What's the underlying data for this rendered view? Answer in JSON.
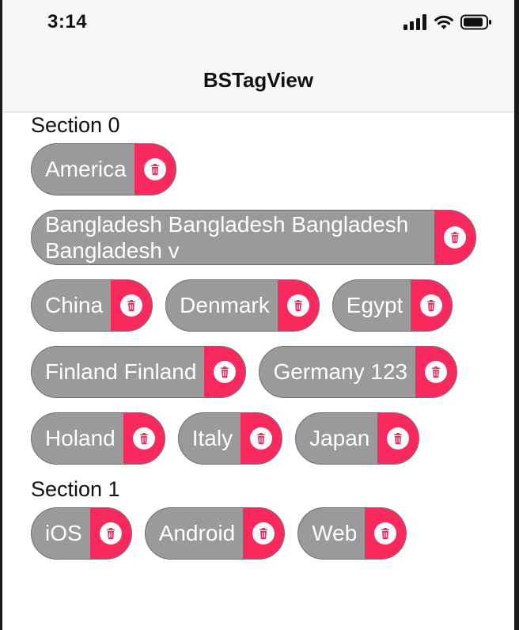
{
  "status_bar": {
    "time": "3:14"
  },
  "nav": {
    "title": "BSTagView"
  },
  "colors": {
    "tag_background": "#9a9a9a",
    "delete_background": "#f8295c"
  },
  "sections": [
    {
      "title": "Section 0",
      "tags": [
        "America",
        "Bangladesh Bangladesh Bangladesh Bangladesh v",
        "China",
        "Denmark",
        "Egypt",
        "Finland Finland",
        "Germany 123",
        "Holand",
        "Italy",
        "Japan"
      ]
    },
    {
      "title": "Section 1",
      "tags": [
        "iOS",
        "Android",
        "Web"
      ]
    }
  ],
  "icons": {
    "delete": "trash-icon",
    "signal": "cellular-signal-icon",
    "wifi": "wifi-icon",
    "battery": "battery-icon"
  }
}
